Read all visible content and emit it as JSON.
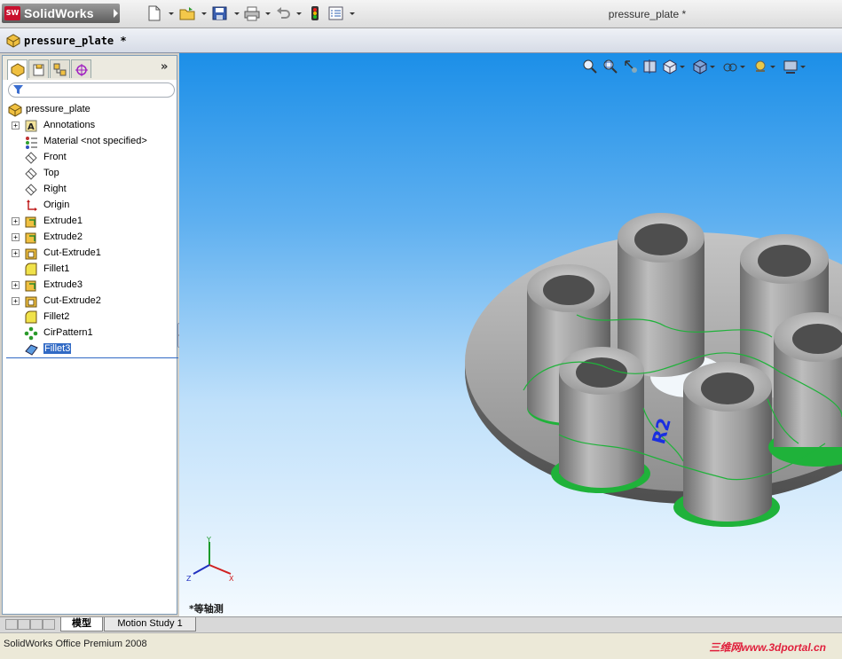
{
  "app": {
    "logo_text": "SolidWorks",
    "window_title": "pressure_plate *"
  },
  "toolbar": {
    "icons": [
      "new-document-icon",
      "open-folder-icon",
      "save-icon",
      "print-icon",
      "undo-icon",
      "rebuild-traffic-light-icon",
      "options-icon"
    ]
  },
  "document": {
    "header_name": "pressure_plate *"
  },
  "feature_tree": {
    "tabs": [
      "feature-manager",
      "property-manager",
      "configuration-manager",
      "dim-xpert-manager"
    ],
    "root": "pressure_plate",
    "items": [
      {
        "label": "Annotations",
        "icon": "annotations-icon",
        "expandable": true
      },
      {
        "label": "Material <not specified>",
        "icon": "material-icon",
        "expandable": false
      },
      {
        "label": "Front",
        "icon": "plane-icon",
        "expandable": false
      },
      {
        "label": "Top",
        "icon": "plane-icon",
        "expandable": false
      },
      {
        "label": "Right",
        "icon": "plane-icon",
        "expandable": false
      },
      {
        "label": "Origin",
        "icon": "origin-icon",
        "expandable": false
      },
      {
        "label": "Extrude1",
        "icon": "extrude-icon",
        "expandable": true
      },
      {
        "label": "Extrude2",
        "icon": "extrude-icon",
        "expandable": true
      },
      {
        "label": "Cut-Extrude1",
        "icon": "cut-extrude-icon",
        "expandable": true
      },
      {
        "label": "Fillet1",
        "icon": "fillet-icon",
        "expandable": false
      },
      {
        "label": "Extrude3",
        "icon": "extrude-icon",
        "expandable": true
      },
      {
        "label": "Cut-Extrude2",
        "icon": "cut-extrude-icon",
        "expandable": true
      },
      {
        "label": "Fillet2",
        "icon": "fillet-icon",
        "expandable": false
      },
      {
        "label": "CirPattern1",
        "icon": "circular-pattern-icon",
        "expandable": false
      },
      {
        "label": "Fillet3",
        "icon": "fillet-icon",
        "expandable": false,
        "selected": true
      }
    ]
  },
  "viewport": {
    "view_name": "*等轴测",
    "dimension_label": "R2",
    "triad_axes": [
      "Y",
      "Z",
      "X"
    ],
    "heads_up_icons": [
      "zoom-to-fit-icon",
      "zoom-to-area-icon",
      "previous-view-icon",
      "section-view-icon",
      "view-orientation-icon",
      "display-style-icon",
      "hide-show-items-icon",
      "edit-appearance-icon",
      "apply-scene-icon"
    ]
  },
  "bottom_tabs": [
    "模型",
    "Motion Study 1"
  ],
  "status": {
    "text": "SolidWorks Office Premium 2008",
    "watermark": "三维网www.3dportal.cn"
  },
  "colors": {
    "selection": "#316ac5",
    "fillet_highlight": "#1fb23a",
    "dimension": "#1a2ee0",
    "viewport_top": "#1c8fe8",
    "viewport_bottom": "#f4faff"
  }
}
